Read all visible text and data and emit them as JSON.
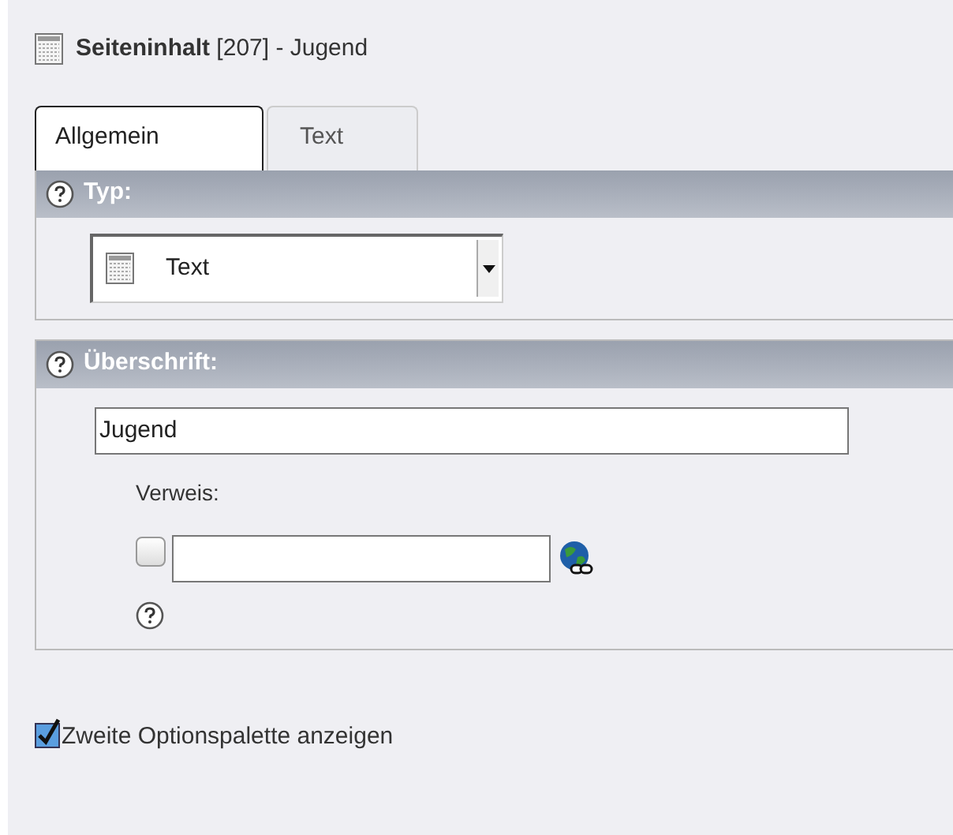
{
  "header": {
    "title": "**Seiteninhalt** [207] - Jugend"
  },
  "tabs": [
    {
      "label": "Allgemein",
      "selected": true
    },
    {
      "label": "Text",
      "selected": false
    }
  ],
  "sections": [
    {
      "title": "Typ:",
      "kind": "select",
      "value": "Text"
    },
    {
      "title": "Überschrift:",
      "kind": "header",
      "value": "Jugend",
      "link_label": "Verweis:",
      "link_checked": false
    }
  ],
  "options_checkbox": {
    "label": "Zweite Optionspalette anzeigen",
    "checked": true
  }
}
